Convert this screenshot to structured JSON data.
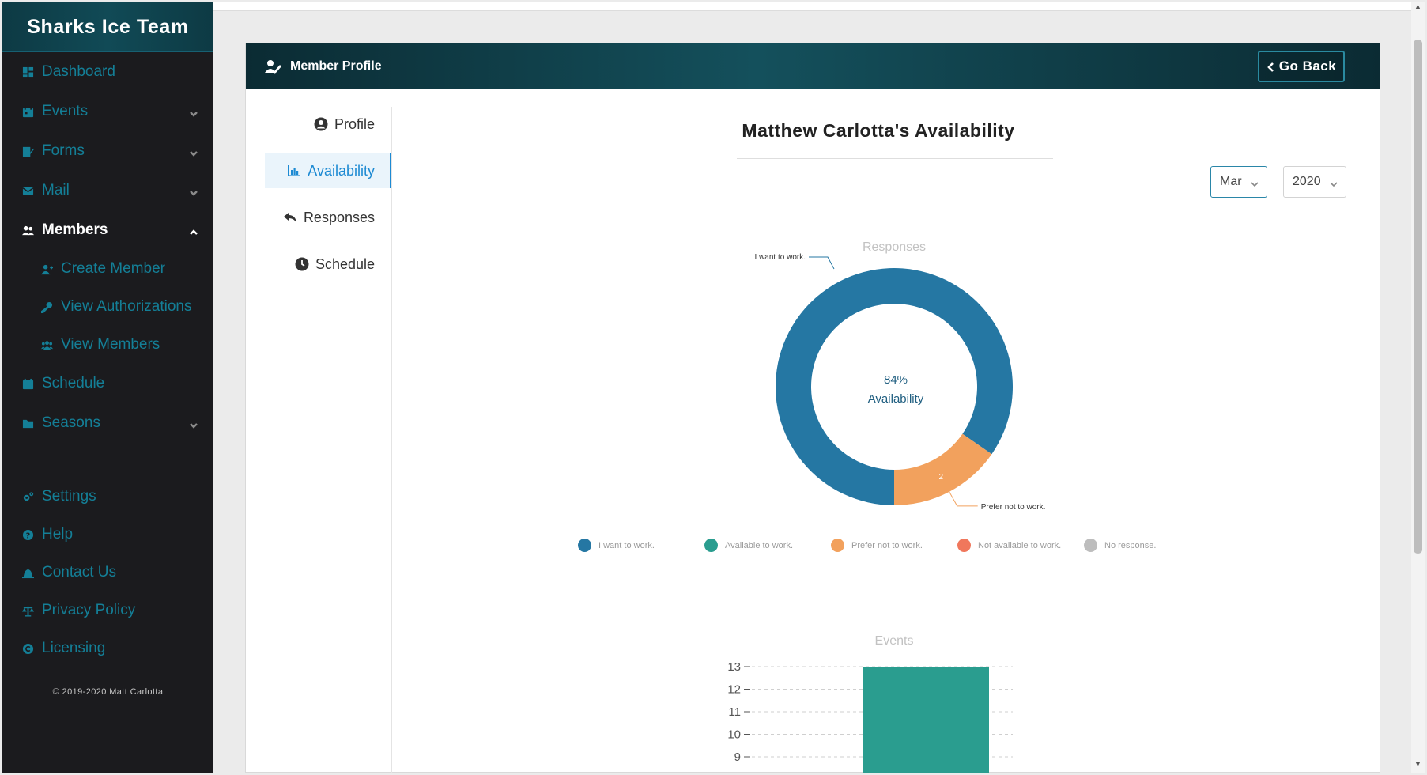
{
  "brand": "Sharks Ice Team",
  "sidebar": {
    "items": [
      {
        "label": "Dashboard",
        "icon": "dashboard-icon",
        "expandable": false
      },
      {
        "label": "Events",
        "icon": "calendar-icon",
        "expandable": true
      },
      {
        "label": "Forms",
        "icon": "form-edit-icon",
        "expandable": true
      },
      {
        "label": "Mail",
        "icon": "mail-icon",
        "expandable": true
      },
      {
        "label": "Members",
        "icon": "users-icon",
        "expandable": true,
        "expanded": true
      }
    ],
    "sub_items": [
      {
        "label": "Create Member",
        "icon": "user-plus-icon"
      },
      {
        "label": "View Authorizations",
        "icon": "key-icon"
      },
      {
        "label": "View Members",
        "icon": "users-icon"
      }
    ],
    "items_after": [
      {
        "label": "Schedule",
        "icon": "calendar-icon"
      },
      {
        "label": "Seasons",
        "icon": "folder-icon"
      }
    ],
    "bottom_items": [
      {
        "label": "Settings",
        "icon": "cogs-icon"
      },
      {
        "label": "Help",
        "icon": "question-icon"
      },
      {
        "label": "Contact Us",
        "icon": "bell-icon"
      },
      {
        "label": "Privacy Policy",
        "icon": "scale-icon"
      },
      {
        "label": "Licensing",
        "icon": "copyright-icon"
      }
    ],
    "copyright": "© 2019-2020 Matt Carlotta"
  },
  "card": {
    "header_title": "Member Profile",
    "go_back_label": "Go Back"
  },
  "tabs": [
    {
      "label": "Profile",
      "icon": "user-circle-icon"
    },
    {
      "label": "Availability",
      "icon": "bar-chart-icon",
      "active": true
    },
    {
      "label": "Responses",
      "icon": "reply-icon"
    },
    {
      "label": "Schedule",
      "icon": "clock-icon"
    }
  ],
  "availability": {
    "title": "Matthew Carlotta's Availability",
    "month": "Mar",
    "year": "2020"
  },
  "colors": {
    "want": "#2577a3",
    "available": "#2a9d8f",
    "prefer_not": "#f2a15d",
    "not_available": "#f0775c",
    "no_response": "#bdbdbd",
    "sidebar_link": "#147f97"
  },
  "chart_data": [
    {
      "type": "pie",
      "title": "Responses",
      "center_value": "84%",
      "center_label": "Availability",
      "slices": [
        {
          "label": "I want to work.",
          "value": 11
        },
        {
          "label": "Prefer not to work.",
          "value": 2
        }
      ],
      "legend": [
        "I want to work.",
        "Available to work.",
        "Prefer not to work.",
        "Not available to work.",
        "No response."
      ],
      "legend_position": "bottom"
    },
    {
      "type": "bar",
      "title": "Events",
      "yticks": [
        9,
        10,
        11,
        12,
        13
      ],
      "ylim": [
        8.4,
        13
      ],
      "values": [
        13
      ],
      "grid": true
    }
  ]
}
